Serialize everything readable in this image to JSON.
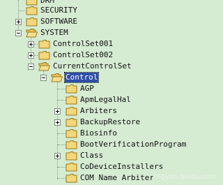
{
  "tree": {
    "nodes": [
      {
        "label": "DRM",
        "expander": "none"
      },
      {
        "label": "SECURITY",
        "expander": "none"
      },
      {
        "label": "SOFTWARE",
        "expander": "plus"
      },
      {
        "label": "SYSTEM",
        "expander": "minus"
      },
      {
        "label": "ControlSet001",
        "expander": "plus"
      },
      {
        "label": "ControlSet002",
        "expander": "plus"
      },
      {
        "label": "CurrentControlSet",
        "expander": "minus"
      },
      {
        "label": "Control",
        "expander": "minus",
        "selected": true
      },
      {
        "label": "AGP",
        "expander": "none"
      },
      {
        "label": "ApmLegalHal",
        "expander": "none"
      },
      {
        "label": "Arbiters",
        "expander": "plus"
      },
      {
        "label": "BackupRestore",
        "expander": "plus"
      },
      {
        "label": "Biosinfo",
        "expander": "none"
      },
      {
        "label": "BootVerificationProgram",
        "expander": "none"
      },
      {
        "label": "Class",
        "expander": "plus"
      },
      {
        "label": "CoDeviceInstallers",
        "expander": "none"
      },
      {
        "label": "COM Name Arbiter",
        "expander": "none"
      }
    ]
  },
  "watermark": "jingyan.baidu.com",
  "colors": {
    "background": "#d5ebd2",
    "selection": "#2f4ea8",
    "folder": "#f3d77a"
  }
}
